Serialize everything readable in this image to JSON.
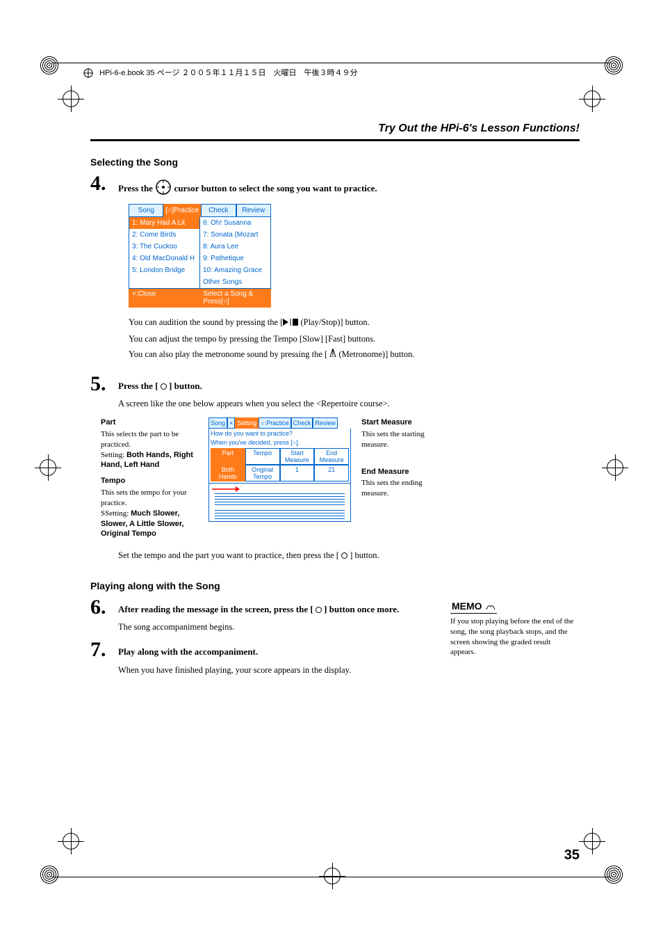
{
  "header": "HPi-6-e.book 35 ページ ２００５年１１月１５日　火曜日　午後３時４９分",
  "section_title": "Try Out the HPi-6's Lesson Functions!",
  "selecting_heading": "Selecting the Song",
  "step4_num": "4.",
  "step4_text_before": "Press the ",
  "step4_text_after": " cursor button to select the song you want to practice.",
  "ss1": {
    "tabs": [
      "Song",
      "[○]Practice",
      "Check",
      "Review"
    ],
    "left": [
      "1: Mary Had A Lit",
      "2: Come Birds",
      "3: The Cuckoo",
      "4: Old MacDonald H",
      "5: London Bridge"
    ],
    "right": [
      "6: Oh! Susanna",
      "7: Sonata (Mozart",
      "8: Aura Lee",
      "9: Pathetique",
      "10: Amazing Grace",
      "Other Songs"
    ],
    "foot_left": "×:Close",
    "foot_right": "Select a Song & Press[○]"
  },
  "notes": {
    "n1a": "You can audition the sound by pressing the [",
    "n1b": " (Play/Stop)] button.",
    "n2": "You can adjust the tempo by pressing the Tempo [Slow] [Fast] buttons.",
    "n3a": "You can also play the metronome sound by pressing the [ ",
    "n3b": " (Metronome)] button."
  },
  "step5_num": "5.",
  "step5_text_a": "Press the [ ",
  "step5_text_b": " ] button.",
  "step5_sub": "A screen like the one below appears when you select the <Repertoire course>.",
  "diagram": {
    "part_h": "Part",
    "part_b": "This selects the part to be practiced.",
    "part_setting_label": "Setting:",
    "part_setting": "Both Hands, Right Hand, Left Hand",
    "tempo_h": "Tempo",
    "tempo_b": "This sets the tempo for your practice.",
    "tempo_setting_label": "Setting:",
    "tempo_setting": "Much Slower, Slower, A Little Slower, Original Tempo",
    "start_h": "Start Measure",
    "start_b": "This sets the starting measure.",
    "end_h": "End Measure",
    "end_b": "This sets the ending measure."
  },
  "ss2": {
    "tabs": [
      "Song",
      "×",
      "Setting",
      "○:Practice",
      "Check",
      "Review"
    ],
    "msg1": "How do you want to practice?",
    "msg2": "When you've decided, press [○].",
    "cols": [
      "Part",
      "Tempo",
      "Start Measure",
      "End Measure"
    ],
    "row2": [
      "Both Hands",
      "Original Tempo",
      "1",
      "21"
    ]
  },
  "set_tempo_line_a": "Set the tempo and the part you want to practice, then press the [ ",
  "set_tempo_line_b": " ] button.",
  "playing_heading": "Playing along with the Song",
  "step6_num": "6.",
  "step6_text_a": "After reading the message in the screen, press the [ ",
  "step6_text_b": " ] button once more.",
  "step6_sub": "The song accompaniment begins.",
  "step7_num": "7.",
  "step7_text": "Play along with the accompaniment.",
  "step7_sub": "When you have finished playing, your score appears in the display.",
  "memo_label": "MEMO",
  "memo_text": "If you stop playing before the end of the song, the song playback stops, and the screen showing the graded result appears.",
  "page_num": "35"
}
